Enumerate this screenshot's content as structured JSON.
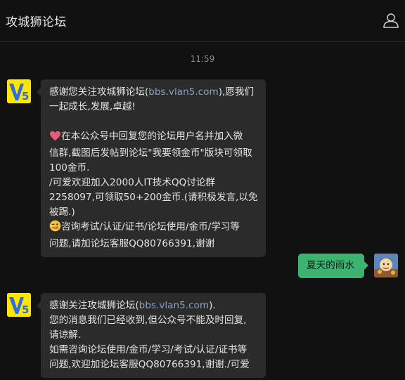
{
  "header": {
    "title": "攻城狮论坛",
    "profile_icon": "user-profile-icon"
  },
  "timestamp": "11:59",
  "messages": [
    {
      "side": "left",
      "sender_avatar": "v5-logo",
      "lines": [
        {
          "pre": "感谢您关注攻城狮论坛(",
          "link": "bbs.vlan5.com",
          "post": "),愿我们"
        },
        {
          "text": "一起成长,发展,卓越!"
        },
        {
          "text": ""
        },
        {
          "emoji": "heart-icon",
          "text": "在本公众号中回复您的论坛用户名并加入微"
        },
        {
          "text": "信群,截图后发帖到论坛\"我要领金币\"版块可领取"
        },
        {
          "text": "100金币."
        },
        {
          "text": "/可爱欢迎加入2000人IT技术QQ讨论群"
        },
        {
          "text": "2258097,可领取50+200金币.(请积极发言,以免"
        },
        {
          "text": "被踢.)"
        },
        {
          "emoji": "wink-face-icon",
          "text": "咨询考试/认证/证书/论坛使用/金币/学习等"
        },
        {
          "text": "问题,请加论坛客服QQ80766391,谢谢"
        }
      ]
    },
    {
      "side": "right",
      "sender_avatar": "user-avatar",
      "text": "夏天的雨水"
    },
    {
      "side": "left",
      "sender_avatar": "v5-logo",
      "lines": [
        {
          "pre": "感谢关注攻城狮论坛(",
          "link": "bbs.vlan5.com",
          "post": ")."
        },
        {
          "text": "您的消息我们已经收到,但公众号不能及时回复,"
        },
        {
          "text": "请谅解."
        },
        {
          "text": "如需咨询论坛使用/金币/学习/考试/认证/证书等"
        },
        {
          "text": "问题,欢迎加论坛客服QQ80766391,谢谢./可爱"
        }
      ]
    }
  ],
  "colors": {
    "background": "#111111",
    "bubble_left": "#2b2b2b",
    "bubble_right": "#3cb371",
    "link": "#8aa2bd",
    "logo_yellow": "#ffe600",
    "logo_blue": "#2f6fd6"
  }
}
